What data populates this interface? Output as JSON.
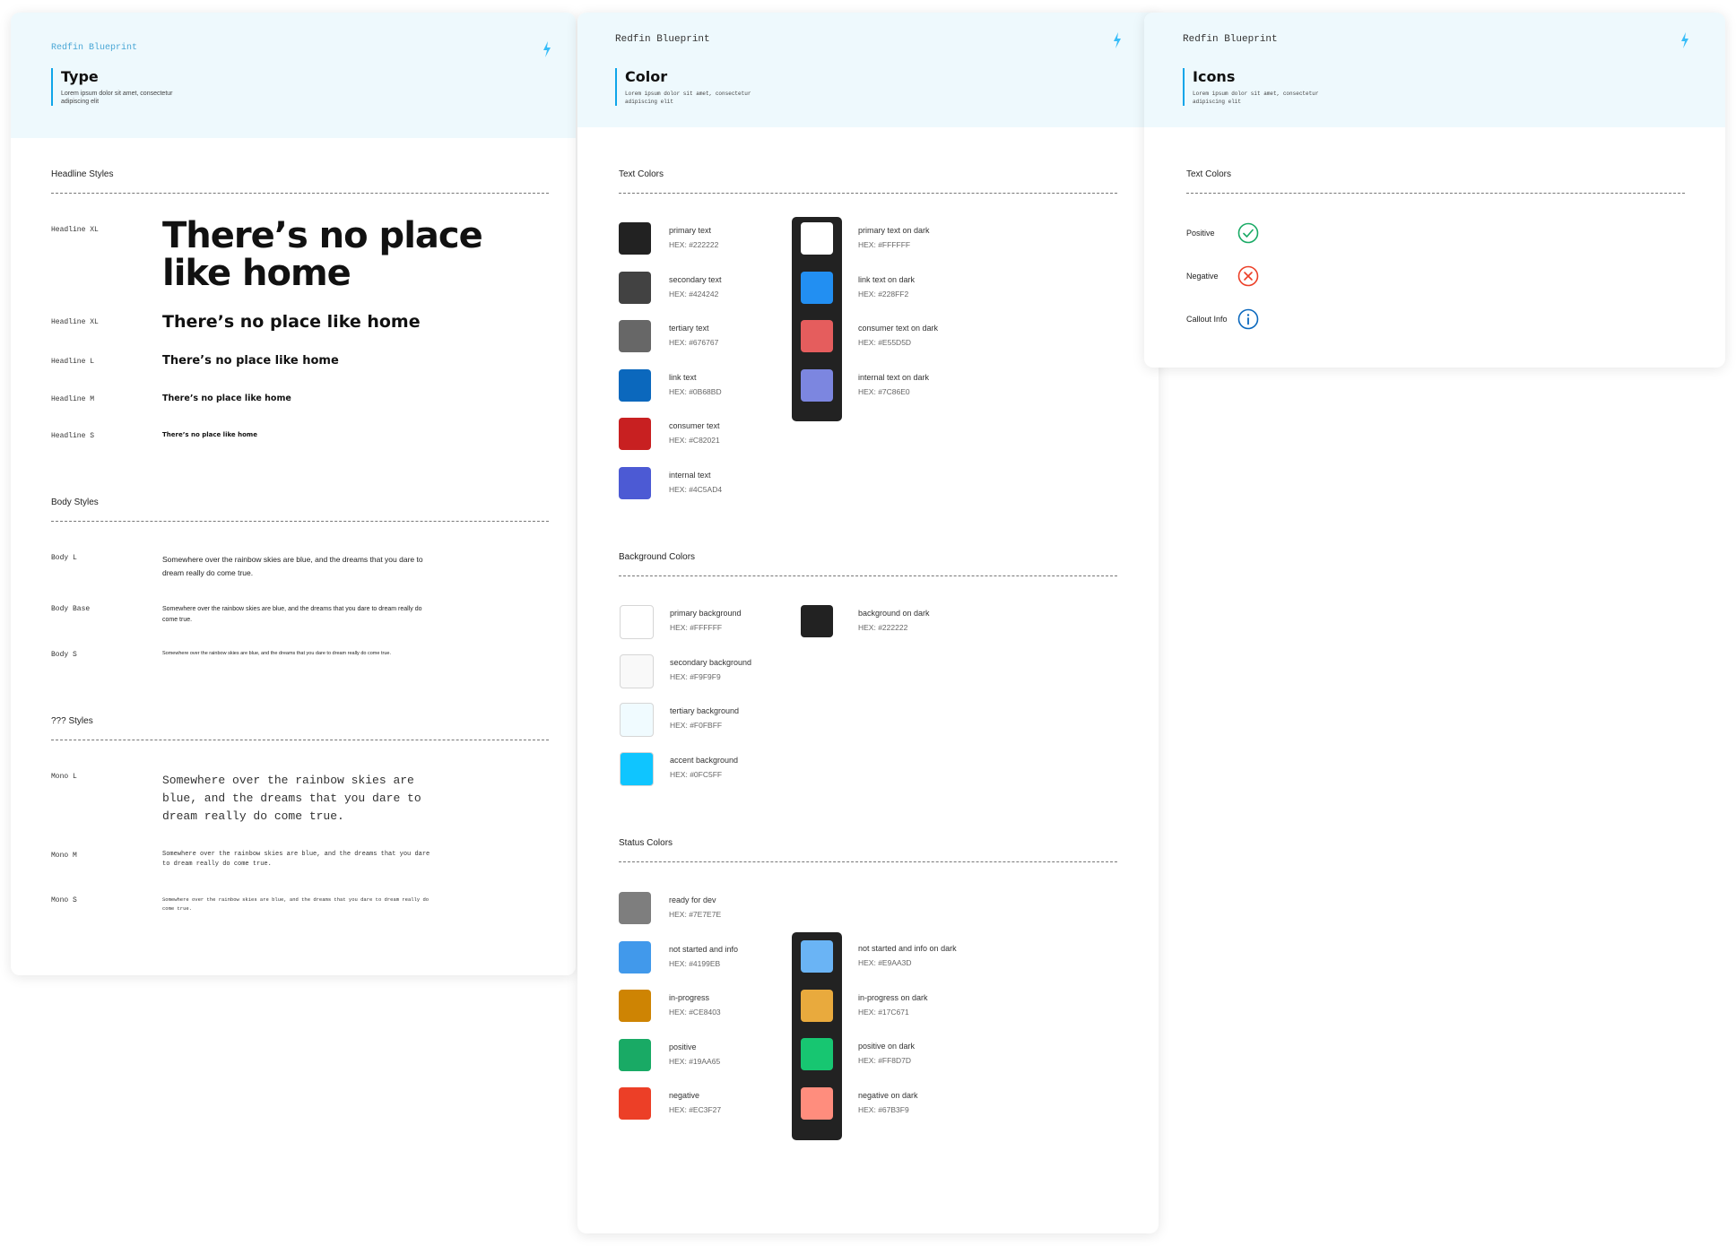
{
  "brand": "Redfin Blueprint",
  "type_card": {
    "title": "Type",
    "description": "Lorem ipsum dolor sit amet, consectetur adipiscing elit",
    "headline_section": "Headline Styles",
    "headlines": [
      {
        "label": "Headline XL",
        "text": "There’s no place like home"
      },
      {
        "label": "Headline XL",
        "text": "There’s no place like home"
      },
      {
        "label": "Headline L",
        "text": "There’s no place like home"
      },
      {
        "label": "Headline M",
        "text": "There’s no place like home"
      },
      {
        "label": "Headline S",
        "text": "There’s no place like home"
      }
    ],
    "body_section": "Body Styles",
    "bodies": [
      {
        "label": "Body L",
        "text": "Somewhere over the rainbow skies are blue, and the dreams that you dare to dream really do come true."
      },
      {
        "label": "Body Base",
        "text": "Somewhere over the rainbow skies are blue, and the dreams that you dare to dream really do come true."
      },
      {
        "label": "Body S",
        "text": "Somewhere over the rainbow skies are blue, and the dreams that you dare to dream really do come true."
      }
    ],
    "mono_section": "??? Styles",
    "monos": [
      {
        "label": "Mono L",
        "text": "Somewhere over the rainbow skies are blue, and the dreams that you dare to dream really do come true."
      },
      {
        "label": "Mono M",
        "text": "Somewhere over the rainbow skies are blue, and the dreams that you dare to dream really do come true."
      },
      {
        "label": "Mono S",
        "text": "Somewhere over the rainbow skies are blue, and the dreams that you dare to dream really do come true."
      }
    ]
  },
  "color_card": {
    "title": "Color",
    "description": "Lorem ipsum dolor sit amet, consectetur adipiscing elit",
    "text_section": "Text Colors",
    "text_colors": [
      {
        "name": "primary text",
        "hex": "HEX: #222222",
        "color": "#222222"
      },
      {
        "name": "secondary text",
        "hex": "HEX: #424242",
        "color": "#424242"
      },
      {
        "name": "tertiary text",
        "hex": "HEX: #676767",
        "color": "#676767"
      },
      {
        "name": "link text",
        "hex": "HEX: #0B68BD",
        "color": "#0B68BD"
      },
      {
        "name": "consumer text",
        "hex": "HEX: #C82021",
        "color": "#C82021"
      },
      {
        "name": "internal text",
        "hex": "HEX: #4C5AD4",
        "color": "#4C5AD4"
      }
    ],
    "text_colors_dark": [
      {
        "name": "primary text on dark",
        "hex": "HEX: #FFFFFF",
        "color": "#FFFFFF"
      },
      {
        "name": "link text on dark",
        "hex": "HEX: #228FF2",
        "color": "#228FF2"
      },
      {
        "name": "consumer text on dark",
        "hex": "HEX: #E55D5D",
        "color": "#E55D5D"
      },
      {
        "name": "internal text on dark",
        "hex": "HEX: #7C86E0",
        "color": "#7C86E0"
      }
    ],
    "bg_section": "Background Colors",
    "bg_colors": [
      {
        "name": "primary background",
        "hex": "HEX: #FFFFFF",
        "color": "#FFFFFF"
      },
      {
        "name": "secondary background",
        "hex": "HEX: #F9F9F9",
        "color": "#F9F9F9"
      },
      {
        "name": "tertiary background",
        "hex": "HEX: #F0FBFF",
        "color": "#F0FBFF"
      },
      {
        "name": "accent background",
        "hex": "HEX: #0FC5FF",
        "color": "#0FC5FF"
      }
    ],
    "bg_colors_dark": [
      {
        "name": "background on dark",
        "hex": "HEX: #222222",
        "color": "#222222"
      }
    ],
    "status_section": "Status Colors",
    "status_colors": [
      {
        "name": "ready for dev",
        "hex": "HEX: #7E7E7E",
        "color": "#7E7E7E"
      },
      {
        "name": "not started and info",
        "hex": "HEX: #4199EB",
        "color": "#4199EB"
      },
      {
        "name": "in-progress",
        "hex": "HEX: #CE8403",
        "color": "#CE8403"
      },
      {
        "name": "positive",
        "hex": "HEX: #19AA65",
        "color": "#19AA65"
      },
      {
        "name": "negative",
        "hex": "HEX: #EC3F27",
        "color": "#EC3F27"
      }
    ],
    "status_colors_dark": [
      {
        "name": "not started and info on dark",
        "hex": "HEX: #E9AA3D",
        "color": "#6AB4F5"
      },
      {
        "name": "in-progress  on dark",
        "hex": "HEX: #17C671",
        "color": "#E9AA3D"
      },
      {
        "name": "positive on dark",
        "hex": "HEX: #FF8D7D",
        "color": "#17C671"
      },
      {
        "name": "negative on dark",
        "hex": "HEX: #67B3F9",
        "color": "#FF8D7D"
      }
    ]
  },
  "icons_card": {
    "title": "Icons",
    "description": "Lorem ipsum dolor sit amet, consectetur adipiscing elit",
    "section": "Text Colors",
    "rows": [
      {
        "label": "Positive",
        "icon": "check-circle-icon",
        "color": "#19AA65"
      },
      {
        "label": "Negative",
        "icon": "x-circle-icon",
        "color": "#EC3F27"
      },
      {
        "label": "Callout Info",
        "icon": "info-circle-icon",
        "color": "#0B68BD"
      }
    ]
  },
  "colors": {
    "accent": "#0ea5e9",
    "header_bg": "#eef9fd"
  }
}
